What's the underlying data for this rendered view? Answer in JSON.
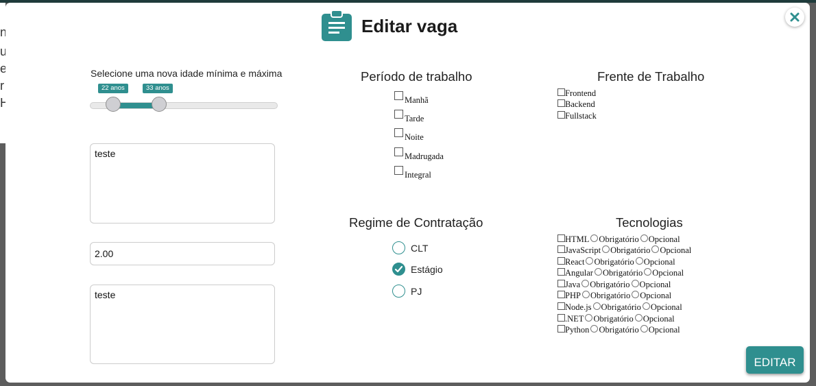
{
  "modal": {
    "title": "Editar vaga",
    "colors": {
      "accent": "#2f8f8f",
      "overlay": "#5d5d5d"
    }
  },
  "age_range": {
    "label": "Selecione uma nova idade mínima e máxima",
    "min_label": "22 anos",
    "max_label": "33 anos",
    "min": 22,
    "max": 33
  },
  "fields": {
    "description": "teste",
    "salary": "2.00",
    "requirements": "teste"
  },
  "periodo": {
    "title": "Período de trabalho",
    "options": [
      "Manhã",
      "Tarde",
      "Noite",
      "Madrugada",
      "Integral"
    ]
  },
  "frente": {
    "title": "Frente de Trabalho",
    "options": [
      "Frontend",
      "Backend",
      "Fullstack"
    ]
  },
  "regime": {
    "title": "Regime de Contratação",
    "options": [
      "CLT",
      "Estágio",
      "PJ"
    ],
    "selected": "Estágio"
  },
  "tecnologias": {
    "title": "Tecnologias",
    "required_label": "Obrigatório",
    "optional_label": "Opcional",
    "items": [
      "HTML",
      "JavaScript",
      "React",
      "Angular",
      "Java",
      "PHP",
      "Node.js",
      ".NET",
      "Python"
    ]
  },
  "actions": {
    "submit": "EDITAR"
  },
  "background": {
    "fragments": [
      "n",
      "u",
      "e",
      "r",
      "H"
    ]
  }
}
